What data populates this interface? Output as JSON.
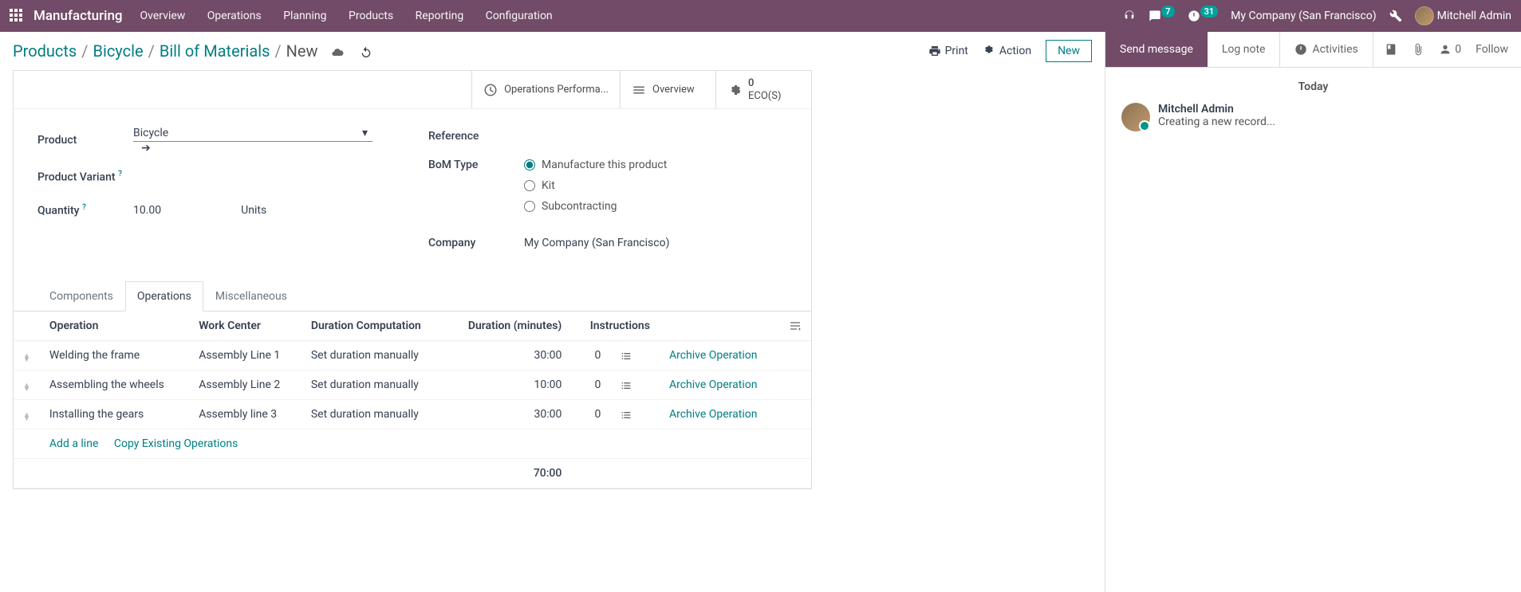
{
  "topbar": {
    "brand": "Manufacturing",
    "menu": [
      "Overview",
      "Operations",
      "Planning",
      "Products",
      "Reporting",
      "Configuration"
    ],
    "messages_badge": "7",
    "activity_badge": "31",
    "company": "My Company (San Francisco)",
    "user": "Mitchell Admin"
  },
  "breadcrumb": {
    "items": [
      "Products",
      "Bicycle",
      "Bill of Materials"
    ],
    "current": "New"
  },
  "cp": {
    "print": "Print",
    "action": "Action",
    "new": "New"
  },
  "stat_buttons": {
    "ops_perf": "Operations Performa...",
    "overview": "Overview",
    "eco_count": "0",
    "eco_label": "ECO(S)"
  },
  "form": {
    "product_label": "Product",
    "product_value": "Bicycle",
    "variant_label": "Product Variant",
    "quantity_label": "Quantity",
    "quantity_value": "10.00",
    "quantity_unit": "Units",
    "reference_label": "Reference",
    "bom_type_label": "BoM Type",
    "bom_type_options": [
      "Manufacture this product",
      "Kit",
      "Subcontracting"
    ],
    "company_label": "Company",
    "company_value": "My Company (San Francisco)"
  },
  "tabs": [
    "Components",
    "Operations",
    "Miscellaneous"
  ],
  "operations_table": {
    "headers": {
      "operation": "Operation",
      "work_center": "Work Center",
      "duration_comp": "Duration Computation",
      "duration_min": "Duration (minutes)",
      "instructions": "Instructions"
    },
    "rows": [
      {
        "operation": "Welding the frame",
        "work_center": "Assembly Line 1",
        "duration_comp": "Set duration manually",
        "duration": "30:00",
        "instructions": "0"
      },
      {
        "operation": "Assembling the wheels",
        "work_center": "Assembly Line 2",
        "duration_comp": "Set duration manually",
        "duration": "10:00",
        "instructions": "0"
      },
      {
        "operation": "Installing the gears",
        "work_center": "Assembly line 3",
        "duration_comp": "Set duration manually",
        "duration": "30:00",
        "instructions": "0"
      }
    ],
    "archive_label": "Archive Operation",
    "add_line": "Add a line",
    "copy_ops": "Copy Existing Operations",
    "total_duration": "70:00"
  },
  "chatter": {
    "send_message": "Send message",
    "log_note": "Log note",
    "activities": "Activities",
    "attach_count": "0",
    "follow": "Follow",
    "today": "Today",
    "author": "Mitchell Admin",
    "text": "Creating a new record..."
  }
}
